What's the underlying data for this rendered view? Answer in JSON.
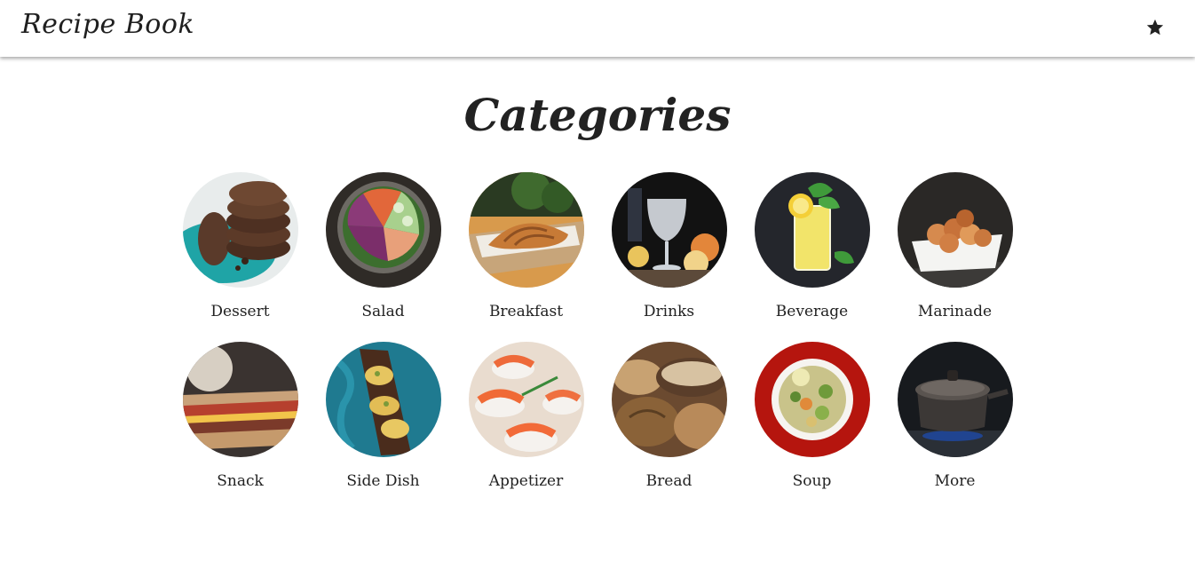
{
  "app": {
    "title": "Recipe Book"
  },
  "header": {
    "favorites_icon": "star-icon"
  },
  "page": {
    "title": "Categories"
  },
  "categories": [
    {
      "label": "Dessert",
      "icon": "cookie-stack-image"
    },
    {
      "label": "Salad",
      "icon": "salad-bowl-image"
    },
    {
      "label": "Breakfast",
      "icon": "croissant-image"
    },
    {
      "label": "Drinks",
      "icon": "cocktail-glass-image"
    },
    {
      "label": "Beverage",
      "icon": "lemonade-glass-image"
    },
    {
      "label": "Marinade",
      "icon": "marinated-chicken-image"
    },
    {
      "label": "Snack",
      "icon": "sandwich-image"
    },
    {
      "label": "Side Dish",
      "icon": "bruschetta-board-image"
    },
    {
      "label": "Appetizer",
      "icon": "salmon-canape-image"
    },
    {
      "label": "Bread",
      "icon": "bread-loaves-image"
    },
    {
      "label": "Soup",
      "icon": "soup-bowl-image"
    },
    {
      "label": "More",
      "icon": "cooking-pot-image"
    }
  ]
}
